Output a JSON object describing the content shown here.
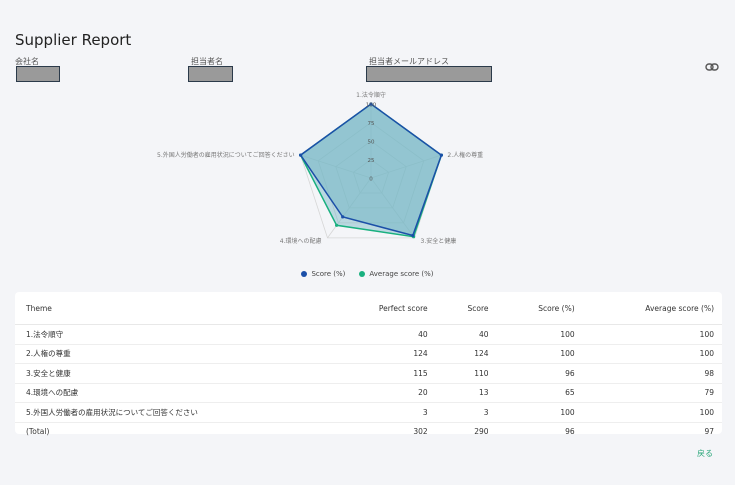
{
  "header": {
    "title": "Supplier Report"
  },
  "fields": [
    {
      "label": "会社名"
    },
    {
      "label": "担当者名"
    },
    {
      "label": "担当者メールアドレス"
    }
  ],
  "icons": {
    "link": "link-icon"
  },
  "chart_data": {
    "type": "radar",
    "axes": [
      "1.法令順守",
      "2.人権の尊重",
      "3.安全と健康",
      "4.環境への配慮",
      "5.外国人労働者の雇用状況についてご回答ください"
    ],
    "ticks": [
      "100",
      "75",
      "50",
      "25",
      "0"
    ],
    "range": [
      0,
      100
    ],
    "series": [
      {
        "name": "Score (%)",
        "values": [
          100,
          100,
          96,
          65,
          100
        ],
        "color": "#1b4fa8"
      },
      {
        "name": "Average score (%)",
        "values": [
          100,
          100,
          98,
          79,
          100
        ],
        "color": "#19b07f"
      }
    ],
    "fill_color": "#73b6c4",
    "legend_position": "bottom"
  },
  "table": {
    "headers": [
      "Theme",
      "Perfect score",
      "Score",
      "Score (%)",
      "Average score (%)"
    ],
    "rows": [
      [
        "1.法令順守",
        "40",
        "40",
        "100",
        "100"
      ],
      [
        "2.人権の尊重",
        "124",
        "124",
        "100",
        "100"
      ],
      [
        "3.安全と健康",
        "115",
        "110",
        "96",
        "98"
      ],
      [
        "4.環境への配慮",
        "20",
        "13",
        "65",
        "79"
      ],
      [
        "5.外国人労働者の雇用状況についてご回答ください",
        "3",
        "3",
        "100",
        "100"
      ],
      [
        "(Total)",
        "302",
        "290",
        "96",
        "97"
      ]
    ]
  },
  "footer": {
    "back_label": "戻る"
  }
}
